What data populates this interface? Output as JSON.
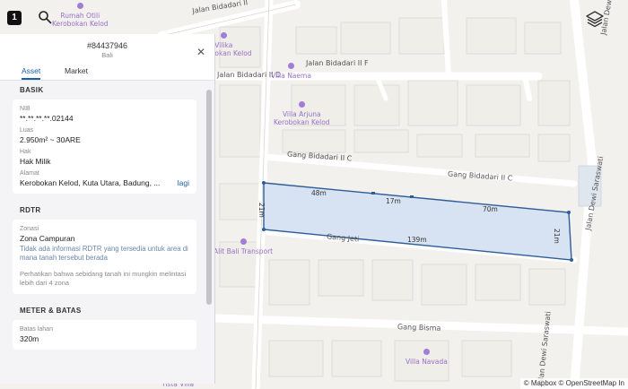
{
  "app": {
    "logo_text": "1"
  },
  "panel": {
    "id": "#84437946",
    "region": "Bali",
    "tabs": [
      "Asset",
      "Market"
    ],
    "active_tab": "Asset",
    "basik": {
      "title": "BASIK",
      "nib_label": "NIB",
      "nib_value": "**.**.**.**.02144",
      "luas_label": "Luas",
      "luas_value": "2.950m² ~ 30ARE",
      "hak_label": "Hak",
      "hak_value": "Hak Milik",
      "alamat_label": "Alamat",
      "alamat_value": "Kerobokan Kelod, Kuta Utara, Badung, ...",
      "more_label": "lagi"
    },
    "rdtr": {
      "title": "RDTR",
      "zonasi_label": "Zonasi",
      "zonasi_value": "Zona Campuran",
      "info_text": "Tidak ada informasi RDTR yang tersedia untuk area di mana tanah tersebut berada",
      "note_text": "Perhatikan bahwa sebidang tanah ini mungkin melintasi lebih dari 4 zona"
    },
    "meter": {
      "title": "METER & BATAS",
      "batas_label": "Batas lahan",
      "batas_value": "320m"
    }
  },
  "map": {
    "streets": {
      "bidadari_ii": "Jalan Bidadari II",
      "bidadari_ii_f": "Jalan Bidadari II F",
      "bidadari_ii_d": "Jalan Bidadari II D",
      "gang_bidadari_ii_c": "Gang Bidadari II C",
      "gang_bidadari_ii_c_east": "Gang Bidadari II C",
      "gang_jeti": "Gang Jeti",
      "gang_bisma": "Gang Bisma",
      "dewi_saraswati_north": "Jalan Dewi",
      "dewi_saraswati": "Jalan Dewi Saraswati",
      "dewi_saraswati_south": "Jalan Dewi Saraswati"
    },
    "pois": {
      "rumah_otili": "Rumah Otili\nKerobokan Kelod",
      "vilika": "Vilika\nKerobokan Kelod",
      "villa_naema": "Villa Naema",
      "villa_arjuna": "Villa Arjuna\nKerobokan Kelod",
      "alit_bali": "Alit Bali Transport",
      "villa_navada": "Villa Navada",
      "tista_villa": "Tista Villa"
    },
    "measurements": {
      "top_a": "48m",
      "top_b": "17m",
      "top_c": "70m",
      "west": "21m",
      "east": "21m",
      "bottom": "139m"
    },
    "parcel_fill": "#d7e3f3",
    "parcel_stroke": "#2e5d98",
    "attribution": "© Mapbox © OpenStreetMap In"
  }
}
